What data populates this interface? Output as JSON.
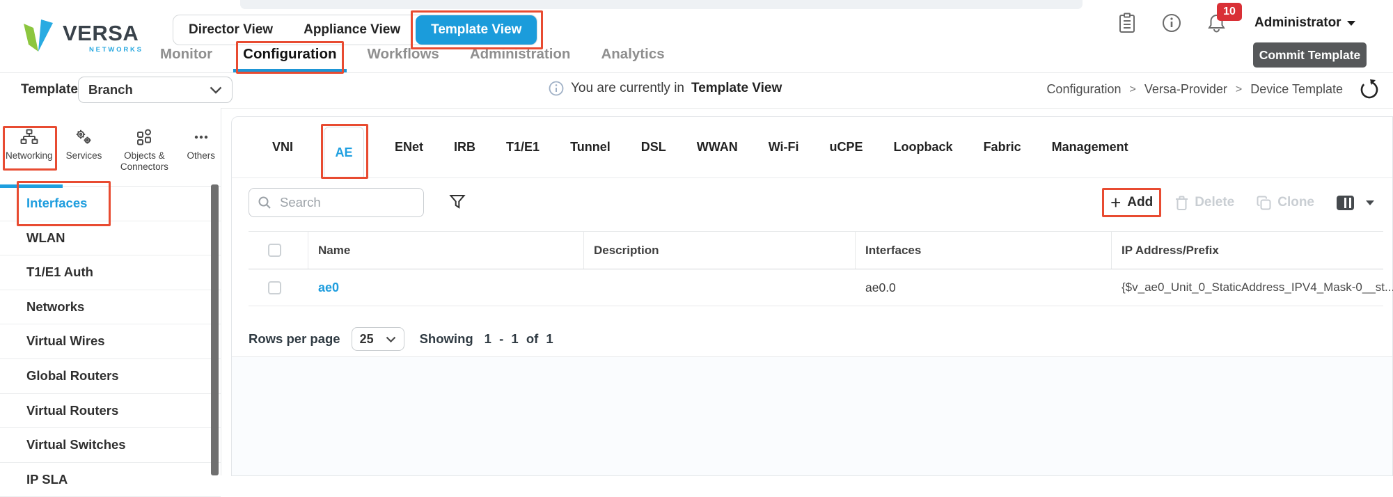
{
  "header": {
    "brand": "VERSA",
    "brand_sub": "NETWORKS",
    "view_switcher": [
      "Director View",
      "Appliance View",
      "Template View"
    ],
    "active_view": "Template View",
    "nav": [
      "Monitor",
      "Configuration",
      "Workflows",
      "Administration",
      "Analytics"
    ],
    "active_nav": "Configuration",
    "notification_badge": "10",
    "user": "Administrator",
    "commit_label": "Commit Template"
  },
  "template_bar": {
    "label": "Template",
    "template_name": "Branch",
    "banner_prefix": "You are currently in",
    "banner_bold": "Template View",
    "breadcrumb": [
      "Configuration",
      "Versa-Provider",
      "Device Template"
    ],
    "breadcrumb_separator": ">"
  },
  "sidebar": {
    "categories": [
      {
        "label": "Networking",
        "icon": "sitemap-icon"
      },
      {
        "label": "Services",
        "icon": "gears-icon"
      },
      {
        "label": "Objects & Connectors",
        "icon": "objects-icon"
      },
      {
        "label": "Others",
        "icon": "ellipsis-icon"
      }
    ],
    "active_category": "Networking",
    "items": [
      "Interfaces",
      "WLAN",
      "T1/E1 Auth",
      "Networks",
      "Virtual Wires",
      "Global Routers",
      "Virtual Routers",
      "Virtual Switches",
      "IP SLA"
    ],
    "active_item": "Interfaces"
  },
  "content": {
    "tabs": [
      "VNI",
      "AE",
      "ENet",
      "IRB",
      "T1/E1",
      "Tunnel",
      "DSL",
      "WWAN",
      "Wi-Fi",
      "uCPE",
      "Loopback",
      "Fabric",
      "Management"
    ],
    "active_tab": "AE",
    "search_placeholder": "Search",
    "toolbar": {
      "add_icon": "+",
      "add": "Add",
      "delete": "Delete",
      "clone": "Clone"
    },
    "table": {
      "columns": [
        "Name",
        "Description",
        "Interfaces",
        "IP Address/Prefix"
      ],
      "rows": [
        {
          "name": "ae0",
          "description": "",
          "interfaces": "ae0.0",
          "ip_address_prefix": "{$v_ae0_Unit_0_StaticAddress_IPV4_Mask-0__st..."
        }
      ]
    },
    "pagination": {
      "rows_per_page_label": "Rows per page",
      "rows_per_page": "25",
      "showing_label": "Showing",
      "range": "1 - 1 of 1"
    }
  },
  "colors": {
    "accent": "#1e9fe0",
    "annotation": "#e84b31",
    "badge": "#d93036",
    "commit_button": "#56585a"
  }
}
